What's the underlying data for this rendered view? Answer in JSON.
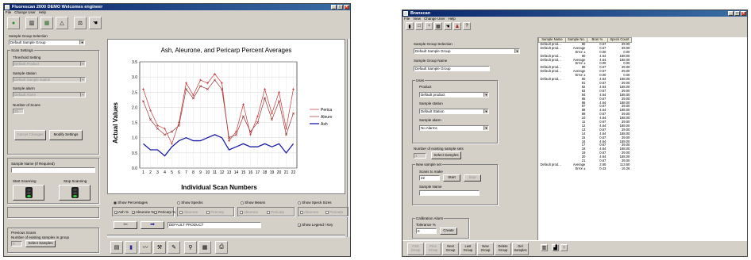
{
  "left_window": {
    "title": "Fluorescan 2000 DEMO Welcomes engineer",
    "menu": [
      "File",
      "Change User",
      "Help"
    ],
    "toolbar_icons": [
      "traffic-light-icon",
      "building-icon",
      "grid-chart-icon",
      "triangle-icon",
      "scale-icon",
      "hand-icon"
    ],
    "sample_group_selection_label": "Sample Group Selection",
    "sample_group_value": "Default Sample Group",
    "scan_settings_label": "Scan Settings",
    "threshold_label": "Threshold Setting",
    "threshold_value": "Default Product",
    "sample_station_label": "Sample station",
    "sample_station_value": "Default Sample station",
    "sample_alarm_label": "Sample alarm",
    "sample_alarm_value": "Default Alarm",
    "number_of_scans_label": "Number of Scans",
    "number_of_scans_value": "20",
    "cancel_changes": "Cancel Changes",
    "modify_settings": "Modify Settings",
    "sample_name_label": "Sample Name (If Required)",
    "sample_name_value": "",
    "start_scanning": "Start Scanning",
    "stop_scanning": "Stop Scanning",
    "previous_scans_label": "Previous Scans",
    "number_existing_label": "Number of existing samples in group",
    "number_existing_value": "0",
    "select_samples": "Select Samples",
    "radio_options": [
      "Show Percentages",
      "Show Specks",
      "Show Means",
      "Show Speck Sizes"
    ],
    "checks": [
      "Ash %",
      "Aleurone %",
      "Pericarp %",
      "Aleurone",
      "Pericarp",
      "Aleurone",
      "Pericarp",
      "Aleurone",
      "Pericarp"
    ],
    "product_display": "DEFAULT PRODUCT",
    "show_legend": "Show Legend / Key",
    "bottom_icons": [
      "table-icon",
      "bar-chart-icon",
      "line-chart-icon",
      "tools-icon",
      "brush-icon",
      "magnifier-icon",
      "sheet-icon",
      "printer-icon"
    ]
  },
  "chart_data": {
    "type": "line",
    "title": "Ash, Aleurone, and Pericarp Percent Averages",
    "xlabel": "Individual Scan Numbers",
    "ylabel": "Actual Values",
    "x": [
      1,
      2,
      3,
      4,
      5,
      6,
      7,
      8,
      9,
      10,
      11,
      12,
      13,
      14,
      15,
      16,
      17,
      18,
      19,
      20,
      21,
      22
    ],
    "ylim": [
      0,
      3.5
    ],
    "yticks": [
      "0.0",
      "0.5",
      "1.0",
      "1.5",
      "2.0",
      "2.5",
      "3.0",
      "3.5"
    ],
    "series": [
      {
        "name": "Pericarp %",
        "color": "#cc3333",
        "values": [
          2.6,
          1.9,
          1.4,
          1.3,
          0.8,
          1.5,
          2.8,
          2.4,
          2.9,
          2.8,
          3.1,
          2.8,
          0.9,
          1.2,
          2.1,
          1.1,
          1.7,
          2.6,
          1.8,
          2.5,
          1.3,
          2.6
        ]
      },
      {
        "name": "Aleurone %",
        "color": "#993333",
        "values": [
          2.2,
          1.6,
          1.3,
          1.1,
          1.2,
          1.4,
          2.6,
          2.3,
          2.7,
          2.6,
          2.9,
          2.6,
          1.0,
          1.1,
          1.7,
          1.2,
          1.5,
          2.3,
          1.6,
          2.2,
          1.1,
          1.8
        ]
      },
      {
        "name": "Ash %",
        "color": "#1a1aaa",
        "values": [
          0.8,
          0.6,
          0.6,
          0.4,
          0.7,
          0.9,
          1.0,
          0.9,
          0.9,
          1.0,
          1.1,
          1.0,
          0.6,
          0.7,
          0.8,
          0.7,
          0.7,
          0.8,
          0.7,
          0.8,
          0.5,
          0.8
        ]
      }
    ],
    "legend": [
      "Perica",
      "Aleuro",
      "Ash"
    ],
    "legend_position": "right"
  },
  "right_window": {
    "title": "Branscan",
    "menu": [
      "File",
      "View",
      "Change User",
      "Help"
    ],
    "toolbar_icons": [
      "bar-icon",
      "square-icon",
      "graph-icon",
      "grid-icon",
      "hand-icon",
      "group-icon",
      "help-icon"
    ],
    "sample_group_selection_label": "Sample Group Selection",
    "sample_group_value": "Default Sample Group",
    "sample_group_name_label": "Sample Group Name",
    "sample_group_name_value": "Default Sample Group",
    "uses_label": "Uses",
    "product_label": "Product",
    "product_value": "Default product",
    "sample_station_label": "Sample station",
    "sample_station_value": "Default Station",
    "sample_alarm_label": "Sample alarm",
    "sample_alarm_value": "No Alarms",
    "existing_sets_label": "Number of existing sample sets",
    "existing_sets_value": "1",
    "select_samples": "Select Samples",
    "new_sample_set_label": "New sample set",
    "scans_to_make_label": "Scans to make",
    "scans_to_make_value": "22",
    "start": "Start",
    "stop": "Stop",
    "sample_name_label": "Sample Name",
    "sample_name_value": "",
    "calibration_alarm_label": "Calibration Alarm",
    "tolerance_label": "Tolerance %",
    "tolerance_value": "0",
    "create": "Create",
    "nav_buttons": [
      "First Group",
      "Prior Group",
      "Next Group",
      "Last Group",
      "New Group",
      "Delete Group",
      "Del Samples"
    ],
    "table_headers": [
      "Sample Name",
      "Sample No.",
      "Bran %",
      "Speck Count"
    ],
    "table_rows": [
      [
        "Default prod...",
        "80",
        "0.67",
        "39.00"
      ],
      [
        "",
        "",
        "",
        ""
      ],
      [
        "Default prod...",
        "Average",
        "0.67",
        "39.00"
      ],
      [
        "",
        "Error ±",
        "0.00",
        "0.00"
      ],
      [
        "",
        "",
        "",
        ""
      ],
      [
        "Default prod...",
        "80",
        "4.64",
        "188.00"
      ],
      [
        "",
        "",
        "",
        ""
      ],
      [
        "Default prod...",
        "Average",
        "4.64",
        "188.00"
      ],
      [
        "",
        "Error ±",
        "0.00",
        "0.00"
      ],
      [
        "",
        "",
        "",
        ""
      ],
      [
        "Default prod...",
        "80",
        "0.67",
        "39.00"
      ],
      [
        "",
        "",
        "",
        ""
      ],
      [
        "Default prod...",
        "Average",
        "0.67",
        "39.00"
      ],
      [
        "",
        "Error ±",
        "0.00",
        "0.00"
      ],
      [
        "",
        "",
        "",
        ""
      ],
      [
        "Default prod...",
        "80",
        "4.64",
        "188.00"
      ],
      [
        "",
        "81",
        "0.67",
        "39.00"
      ],
      [
        "",
        "82",
        "4.64",
        "188.00"
      ],
      [
        "",
        "83",
        "0.67",
        "39.00"
      ],
      [
        "",
        "84",
        "4.64",
        "188.00"
      ],
      [
        "",
        "85",
        "0.67",
        "39.00"
      ],
      [
        "",
        "86",
        "4.64",
        "188.00"
      ],
      [
        "",
        "87",
        "0.67",
        "39.00"
      ],
      [
        "",
        "88",
        "4.64",
        "188.00"
      ],
      [
        "",
        "89",
        "0.67",
        "39.00"
      ],
      [
        "",
        "10",
        "4.64",
        "188.00"
      ],
      [
        "",
        "11",
        "0.67",
        "39.00"
      ],
      [
        "",
        "12",
        "4.64",
        "188.00"
      ],
      [
        "",
        "13",
        "0.67",
        "39.00"
      ],
      [
        "",
        "14",
        "4.64",
        "188.00"
      ],
      [
        "",
        "15",
        "0.67",
        "39.00"
      ],
      [
        "",
        "16",
        "4.64",
        "188.00"
      ],
      [
        "",
        "17",
        "0.67",
        "39.00"
      ],
      [
        "",
        "18",
        "4.64",
        "188.00"
      ],
      [
        "",
        "19",
        "0.67",
        "39.00"
      ],
      [
        "",
        "20",
        "4.64",
        "188.00"
      ],
      [
        "",
        "21",
        "0.67",
        "39.00"
      ],
      [
        "",
        "",
        "",
        ""
      ],
      [
        "Default prod...",
        "Average",
        "2.65",
        "113.50"
      ],
      [
        "",
        "Error ±",
        "0.43",
        "16.26"
      ]
    ],
    "bottom_icons": [
      "grid-icon",
      "chart-icon",
      "scatter-icon"
    ]
  }
}
